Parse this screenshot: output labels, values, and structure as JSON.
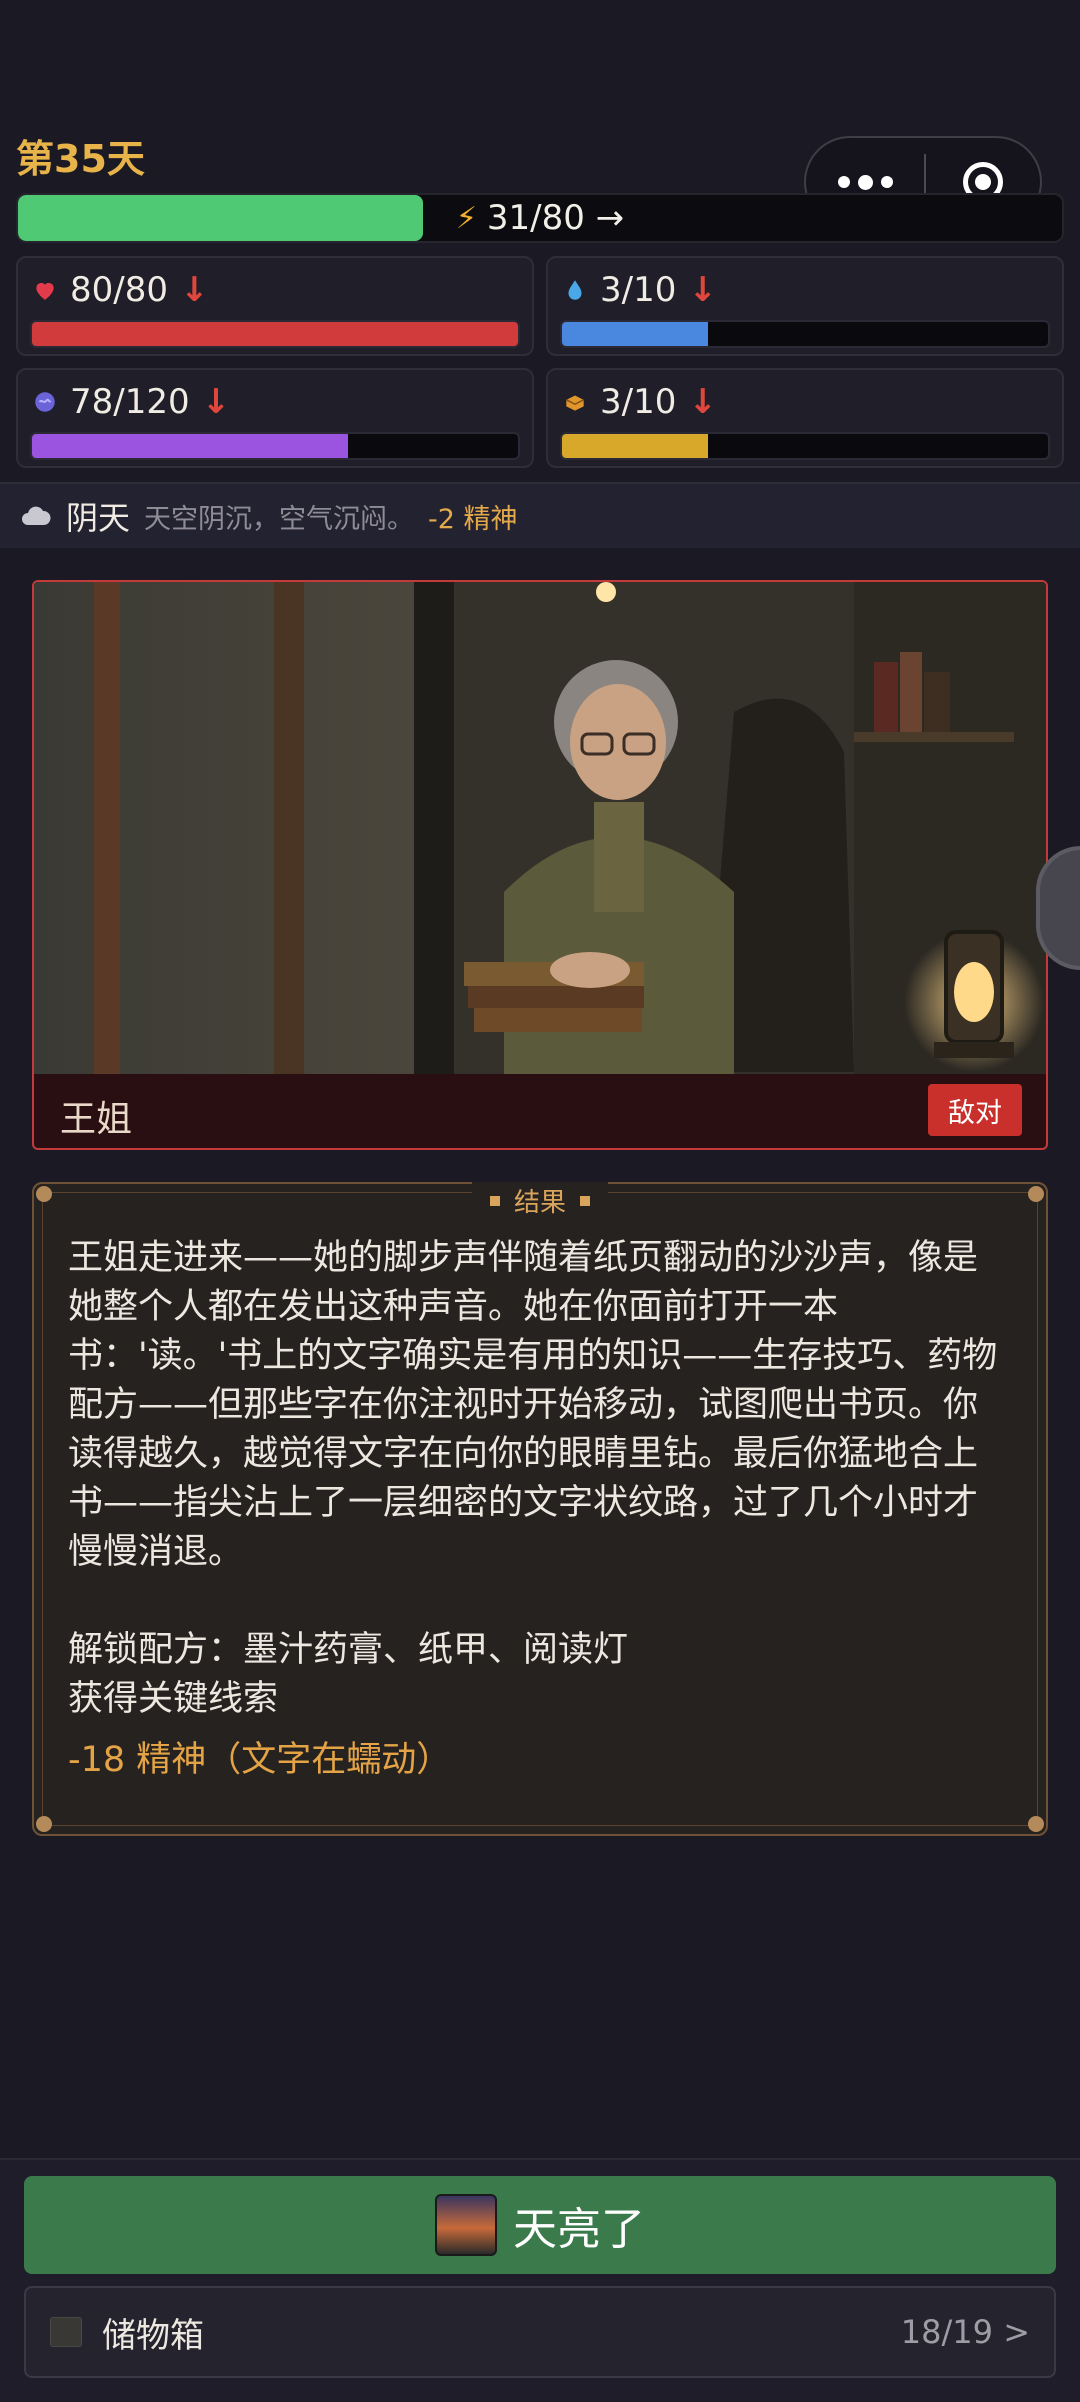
{
  "header": {
    "day_label": "第35天"
  },
  "energy": {
    "text": "31/80 →",
    "value": 31,
    "max": 80,
    "color": "#4fc974",
    "icon": "lightning-icon"
  },
  "stats": [
    {
      "icon": "heart-icon",
      "text": "80/80",
      "trend": "↓",
      "value": 80,
      "max": 80,
      "color": "#d13b3b"
    },
    {
      "icon": "water-drop-icon",
      "text": "3/10",
      "trend": "↓",
      "value": 3,
      "max": 10,
      "color": "#4a88e0"
    },
    {
      "icon": "brain-icon",
      "text": "78/120",
      "trend": "↓",
      "value": 78,
      "max": 120,
      "color": "#9a54e0"
    },
    {
      "icon": "food-icon",
      "text": "3/10",
      "trend": "↓",
      "value": 3,
      "max": 10,
      "color": "#d8a82a"
    }
  ],
  "weather": {
    "icon": "cloud-icon",
    "title": "阴天",
    "desc": "天空阴沉，空气沉闷。",
    "effect": "-2 精神"
  },
  "character": {
    "name": "王姐",
    "tag": "敌对"
  },
  "result": {
    "title": "结果",
    "paragraph": "王姐走进来——她的脚步声伴随着纸页翻动的沙沙声，像是她整个人都在发出这种声音。她在你面前打开一本书：'读。'书上的文字确实是有用的知识——生存技巧、药物配方——但那些字在你注视时开始移动，试图爬出书页。你读得越久，越觉得文字在向你的眼睛里钻。最后你猛地合上书——指尖沾上了一层细密的文字状纹路，过了几个小时才慢慢消退。",
    "unlock": "解锁配方：墨汁药膏、纸甲、阅读灯",
    "clue": "获得关键线索",
    "penalty": "-18 精神（文字在蠕动）"
  },
  "actions": {
    "dawn_label": "天亮了",
    "storage_label": "储物箱",
    "storage_count": "18/19 >"
  }
}
